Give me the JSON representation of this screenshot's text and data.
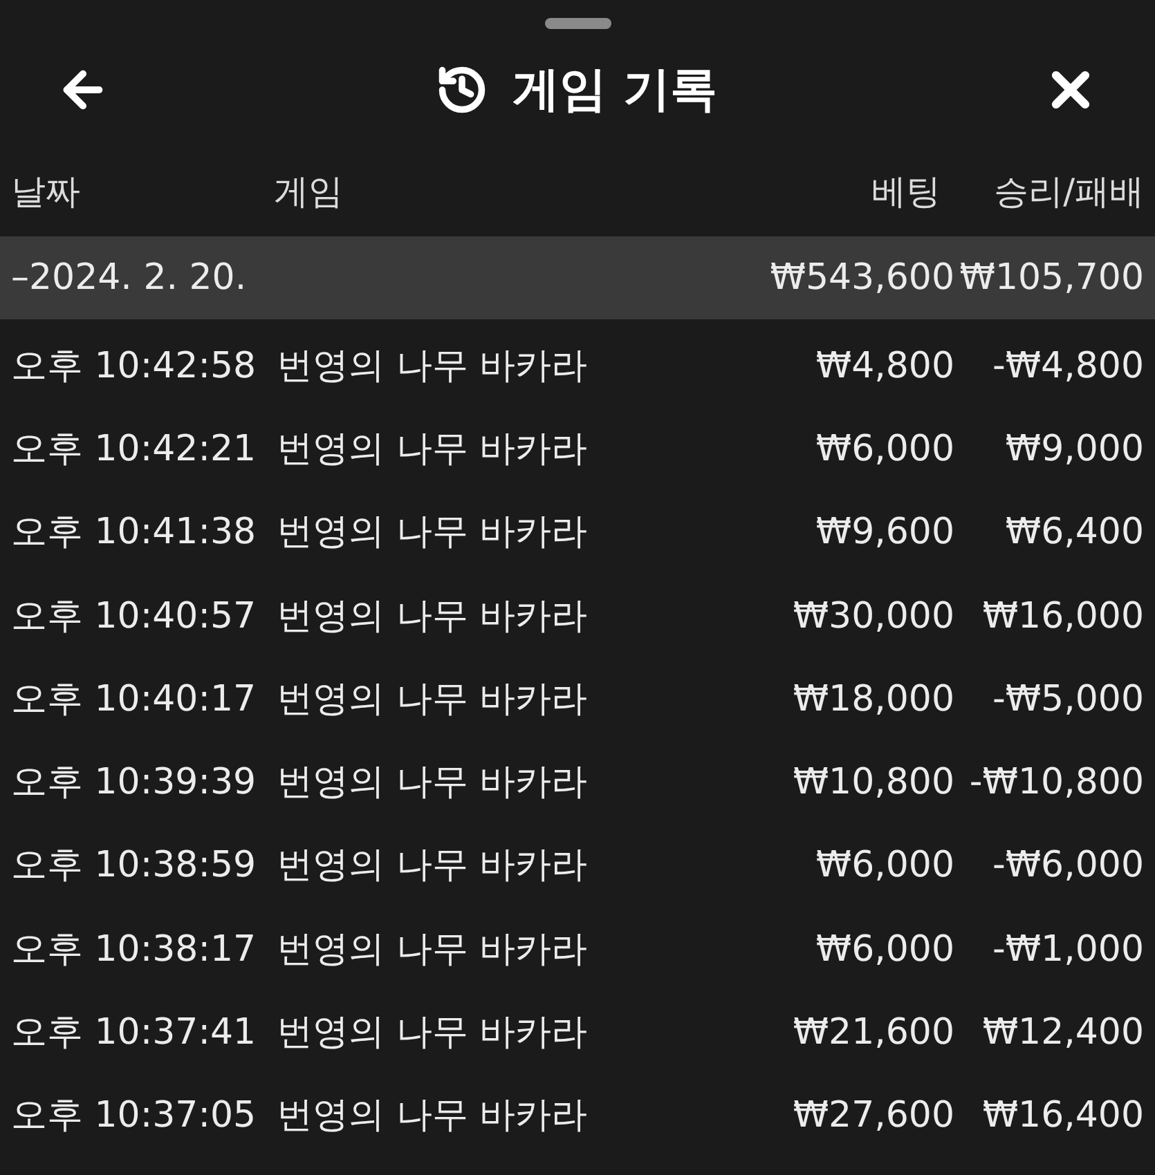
{
  "header": {
    "title": "게임 기록"
  },
  "columns": [
    "날짜",
    "게임",
    "베팅",
    "승리/패배"
  ],
  "date_group": {
    "date": "–2024. 2. 20.",
    "bet": "₩543,600",
    "result": "₩105,700"
  },
  "rows": [
    {
      "time": "오후 10:42:58",
      "game": "번영의 나무 바카라",
      "bet": "₩4,800",
      "result": "-₩4,800"
    },
    {
      "time": "오후 10:42:21",
      "game": "번영의 나무 바카라",
      "bet": "₩6,000",
      "result": "₩9,000"
    },
    {
      "time": "오후 10:41:38",
      "game": "번영의 나무 바카라",
      "bet": "₩9,600",
      "result": "₩6,400"
    },
    {
      "time": "오후 10:40:57",
      "game": "번영의 나무 바카라",
      "bet": "₩30,000",
      "result": "₩16,000"
    },
    {
      "time": "오후 10:40:17",
      "game": "번영의 나무 바카라",
      "bet": "₩18,000",
      "result": "-₩5,000"
    },
    {
      "time": "오후 10:39:39",
      "game": "번영의 나무 바카라",
      "bet": "₩10,800",
      "result": "-₩10,800"
    },
    {
      "time": "오후 10:38:59",
      "game": "번영의 나무 바카라",
      "bet": "₩6,000",
      "result": "-₩6,000"
    },
    {
      "time": "오후 10:38:17",
      "game": "번영의 나무 바카라",
      "bet": "₩6,000",
      "result": "-₩1,000"
    },
    {
      "time": "오후 10:37:41",
      "game": "번영의 나무 바카라",
      "bet": "₩21,600",
      "result": "₩12,400"
    },
    {
      "time": "오후 10:37:05",
      "game": "번영의 나무 바카라",
      "bet": "₩27,600",
      "result": "₩16,400"
    }
  ]
}
